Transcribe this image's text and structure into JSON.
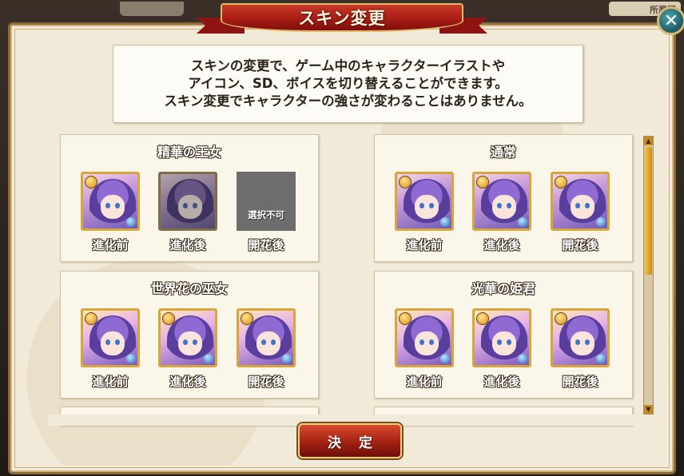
{
  "background": {
    "left_tab": "",
    "right_tab": "所属国"
  },
  "dialog": {
    "title": "スキン変更",
    "close_label": "✕",
    "info_lines": [
      "スキンの変更で、ゲーム中のキャラクターイラストや",
      "アイコン、SD、ボイスを切り替えることができます。",
      "スキン変更でキャラクターの強さが変わることはありません。"
    ],
    "confirm_label": "決定"
  },
  "skins": [
    {
      "name": "精華の王女",
      "slots": [
        {
          "label": "進化前",
          "state": "available"
        },
        {
          "label": "進化後",
          "state": "available"
        },
        {
          "label": "開花後",
          "state": "locked",
          "locked_text": "選択不可"
        }
      ]
    },
    {
      "name": "通常",
      "slots": [
        {
          "label": "進化前",
          "state": "available"
        },
        {
          "label": "進化後",
          "state": "available"
        },
        {
          "label": "開花後",
          "state": "available"
        }
      ]
    },
    {
      "name": "世界花の巫女",
      "slots": [
        {
          "label": "進化前",
          "state": "available"
        },
        {
          "label": "進化後",
          "state": "available"
        },
        {
          "label": "開花後",
          "state": "available"
        }
      ]
    },
    {
      "name": "光華の姫君",
      "slots": [
        {
          "label": "進化前",
          "state": "available"
        },
        {
          "label": "進化後",
          "state": "available"
        },
        {
          "label": "開花後",
          "state": "available"
        }
      ]
    }
  ],
  "scroll": {
    "up": "▲",
    "down": "▼"
  },
  "colors": {
    "ribbon": "#a81d14",
    "frame_gold": "#d8a53a",
    "panel_bg": "#fbf6ea"
  }
}
